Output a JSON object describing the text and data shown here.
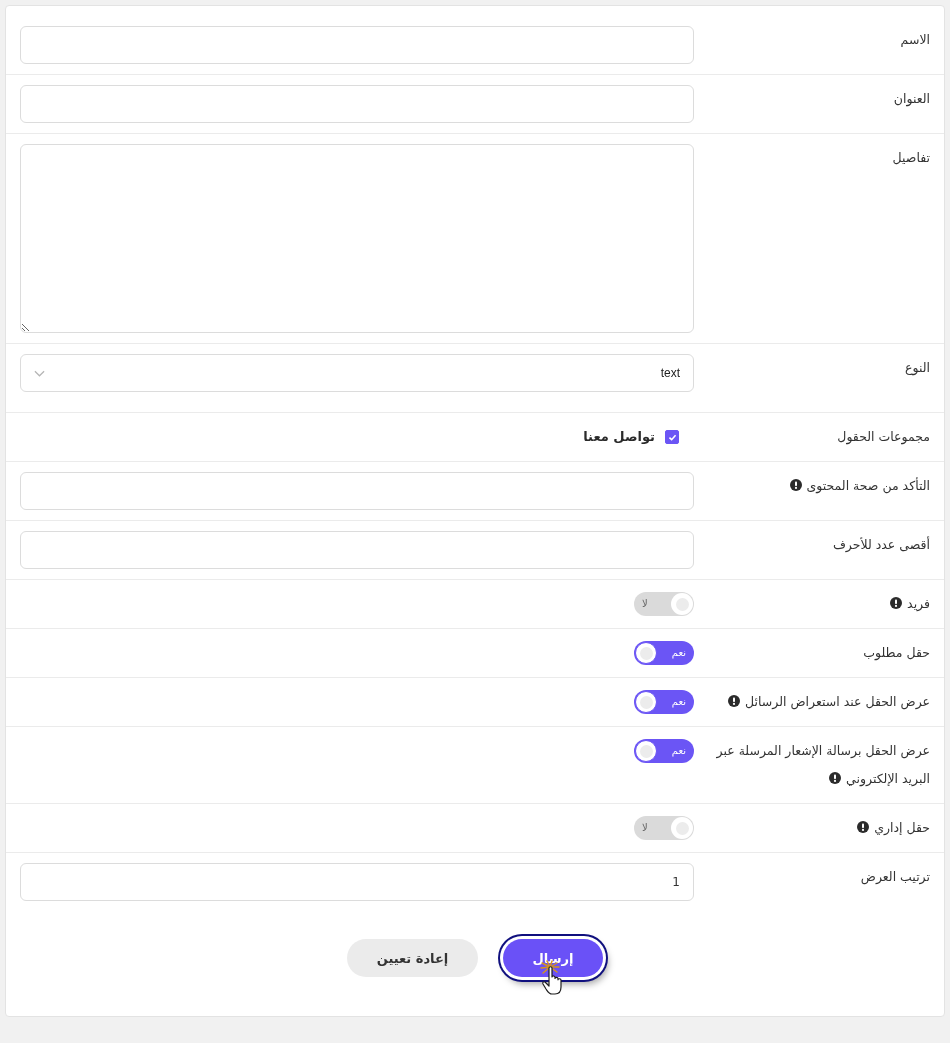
{
  "form": {
    "fields": [
      {
        "kind": "text",
        "label": "الاسم",
        "info": false
      },
      {
        "kind": "text",
        "label": "العنوان",
        "info": false
      },
      {
        "kind": "textarea",
        "label": "تفاصيل",
        "info": false
      },
      {
        "kind": "select",
        "label": "النوع",
        "info": false,
        "value": "text"
      },
      {
        "kind": "checkboxes",
        "label": "مجموعات الحقول",
        "info": false,
        "options": [
          {
            "label": "تواصل معنا",
            "checked": true
          }
        ]
      },
      {
        "kind": "text",
        "label": "التأكد من صحة المحتوى",
        "info": true
      },
      {
        "kind": "text",
        "label": "أقصى عدد للأحرف",
        "info": false
      },
      {
        "kind": "toggle",
        "label": "فريد",
        "info": true,
        "on": false,
        "toggle_text": "لا"
      },
      {
        "kind": "toggle",
        "label": "حقل مطلوب",
        "info": false,
        "on": true,
        "toggle_text": "نعم"
      },
      {
        "kind": "toggle",
        "label": "عرض الحقل عند استعراض الرسائل",
        "info": true,
        "on": true,
        "toggle_text": "نعم"
      },
      {
        "kind": "toggle",
        "label": "عرض الحقل برسالة الإشعار المرسلة عبر البريد الإلكتروني",
        "info": true,
        "on": true,
        "toggle_text": "نعم"
      },
      {
        "kind": "toggle",
        "label": "حقل إداري",
        "info": true,
        "on": false,
        "toggle_text": "لا"
      },
      {
        "kind": "text",
        "label": "ترتيب العرض",
        "info": false,
        "value": "1"
      }
    ]
  },
  "buttons": [
    {
      "kind": "primary",
      "label": "إرسال",
      "focused": true
    },
    {
      "kind": "secondary",
      "label": "إعادة تعيين",
      "focused": false
    }
  ]
}
